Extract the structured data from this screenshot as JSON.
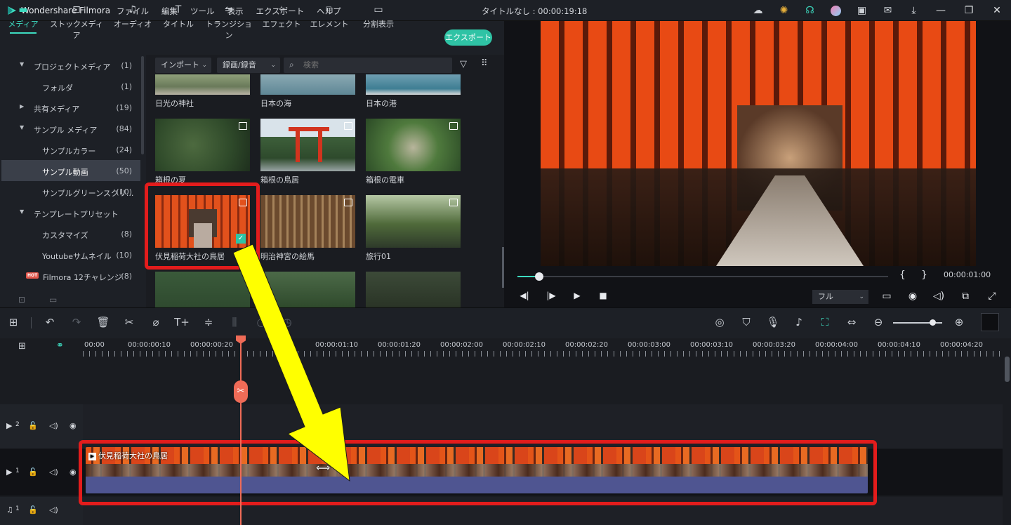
{
  "app": {
    "name": "Wondershare Filmora",
    "menu": [
      "ファイル",
      "編集",
      "ツール",
      "表示",
      "エクスポート",
      "ヘルプ"
    ],
    "doc_title": "タイトルなし : 00:00:19:18",
    "title_icons": [
      "cloud-icon",
      "lightbulb-icon",
      "headset-icon",
      "avatar-icon",
      "save-icon",
      "mail-icon",
      "download-icon"
    ]
  },
  "tabs": [
    {
      "label": "メディア",
      "icon": "folder-icon"
    },
    {
      "label": "ストックメディア",
      "icon": "stock-media-icon"
    },
    {
      "label": "オーディオ",
      "icon": "music-note-icon"
    },
    {
      "label": "タイトル",
      "icon": "text-title-icon"
    },
    {
      "label": "トランジション",
      "icon": "transition-icon"
    },
    {
      "label": "エフェクト",
      "icon": "effect-icon"
    },
    {
      "label": "エレメント",
      "icon": "element-icon"
    },
    {
      "label": "分割表示",
      "icon": "split-screen-icon"
    }
  ],
  "export_label": "エクスポート",
  "sidebar": {
    "items": [
      {
        "label": "プロジェクトメディア",
        "count": "(1)"
      },
      {
        "label": "フォルダ",
        "count": "(1)"
      },
      {
        "label": "共有メディア",
        "count": "(19)"
      },
      {
        "label": "サンプル メディア",
        "count": "(84)"
      },
      {
        "label": "サンプルカラー",
        "count": "(24)"
      },
      {
        "label": "サンプル動画",
        "count": "(50)"
      },
      {
        "label": "サンプルグリーンスクリ...",
        "count": "(10)"
      },
      {
        "label": "テンプレートプリセット",
        "count": ""
      },
      {
        "label": "カスタマイズ",
        "count": "(8)"
      },
      {
        "label": "Youtubeサムネイル",
        "count": "(10)"
      },
      {
        "label": "Filmora 12チャレンジ",
        "count": "(8)"
      }
    ],
    "hot_badge": "HOT"
  },
  "media": {
    "import_label": "インポート",
    "record_label": "録画/録音",
    "search_placeholder": "検索",
    "items": [
      {
        "label": "日光の神社"
      },
      {
        "label": "日本の海"
      },
      {
        "label": "日本の港"
      },
      {
        "label": "箱根の夏"
      },
      {
        "label": "箱根の鳥居"
      },
      {
        "label": "箱根の電車"
      },
      {
        "label": "伏見稲荷大社の鳥居"
      },
      {
        "label": "明治神宮の絵馬"
      },
      {
        "label": "旅行01"
      }
    ]
  },
  "preview": {
    "time": "00:00:01:00",
    "progress": 0.06,
    "quality": "フル",
    "brace_left": "{",
    "brace_right": "}"
  },
  "timeline": {
    "ruler": [
      "00:00",
      "00:00:00:10",
      "00:00:00:20",
      "00:00",
      "00:00:01:10",
      "00:00:01:20",
      "00:00:02:00",
      "00:00:02:10",
      "00:00:02:20",
      "00:00:03:00",
      "00:00:03:10",
      "00:00:03:20",
      "00:00:04:00",
      "00:00:04:10",
      "00:00:04:20"
    ],
    "tracks": [
      {
        "label": "2"
      },
      {
        "label": "1"
      },
      {
        "label": "1"
      }
    ],
    "clip_title": "伏見稲荷大社の鳥居",
    "zoom": 0.8
  },
  "colors": {
    "accent": "#3ddbc0",
    "highlight": "#e31c1c",
    "arrow": "#ffff00",
    "audio": "#4f5591"
  }
}
